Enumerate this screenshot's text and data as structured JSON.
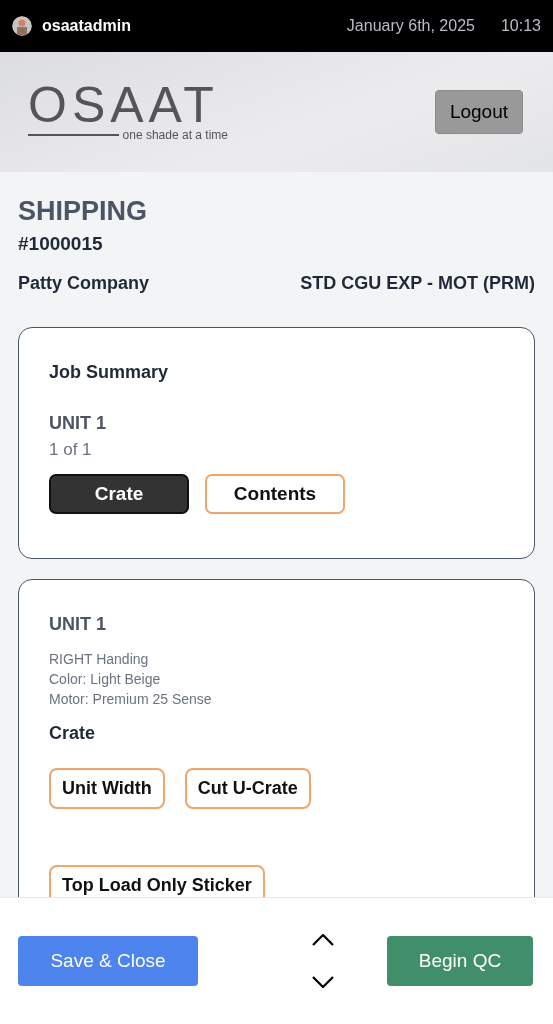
{
  "status_bar": {
    "username": "osaatadmin",
    "date": "January 6th, 2025",
    "time": "10:13"
  },
  "header": {
    "logo": "OSAAT",
    "tagline": "one shade at a time",
    "logout": "Logout"
  },
  "page": {
    "title": "SHIPPING",
    "order_number": "#1000015",
    "customer": "Patty Company",
    "service": "STD CGU EXP - MOT (PRM)"
  },
  "job_summary": {
    "title": "Job Summary",
    "unit": "UNIT 1",
    "count": "1 of 1",
    "toggles": [
      {
        "label": "Crate",
        "selected": true
      },
      {
        "label": "Contents",
        "selected": false
      }
    ]
  },
  "unit_card": {
    "unit": "UNIT 1",
    "details": [
      "RIGHT Handing",
      "Color: Light Beige",
      "Motor: Premium 25 Sense"
    ],
    "section": "Crate",
    "chips": [
      {
        "label": "Unit Width"
      },
      {
        "label": "Cut U-Crate"
      },
      {
        "label": "Top Load Only Sticker"
      }
    ]
  },
  "footer": {
    "save": "Save & Close",
    "begin": "Begin QC"
  }
}
